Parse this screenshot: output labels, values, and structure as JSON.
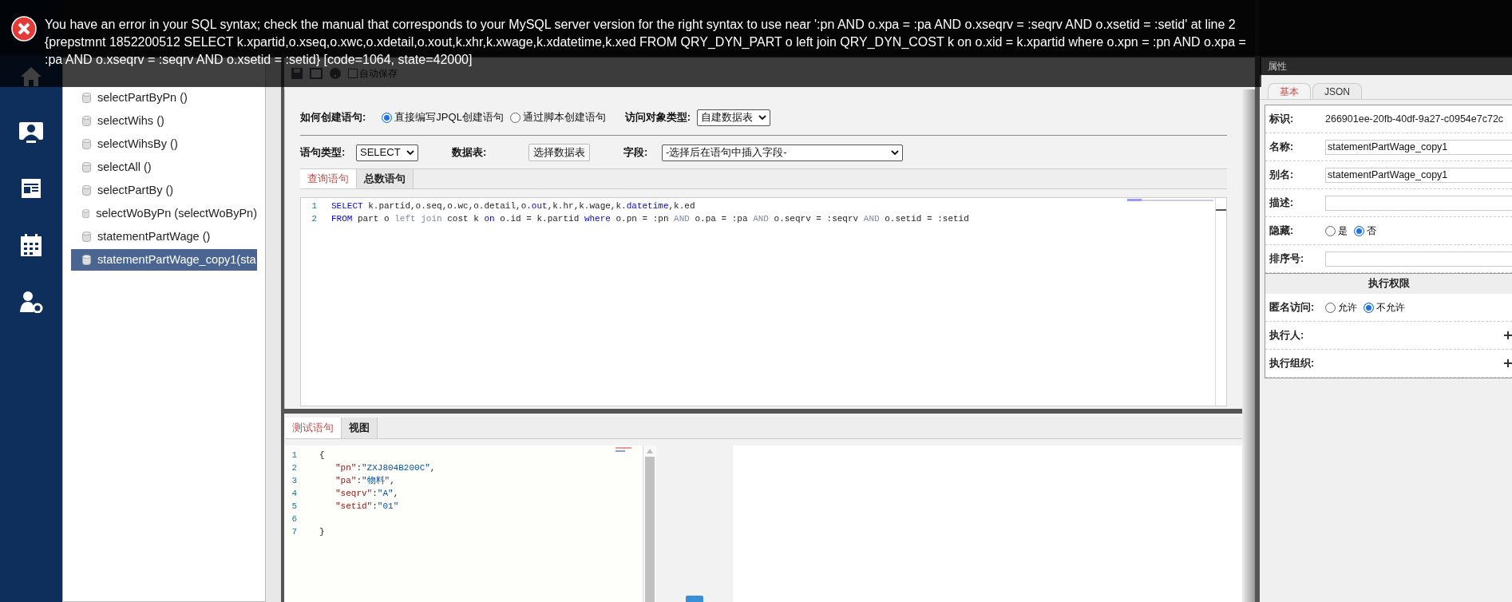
{
  "error_toast": {
    "message": "You have an error in your SQL syntax; check the manual that corresponds to your MySQL server version for the right syntax to use near ':pn AND o.xpa = :pa AND o.xseqrv = :seqrv AND o.xsetid = :setid' at line 2 {prepstmnt 1852200512 SELECT k.xpartid,o.xseq,o.xwc,o.xdetail,o.xout,k.xhr,k.xwage,k.xdatetime,k.xed FROM QRY_DYN_PART o left join QRY_DYN_COST k on o.xid = k.xpartid where o.xpn = :pn AND o.xpa = :pa AND o.xseqrv = :seqrv AND o.xsetid = :setid} [code=1064, state=42000]"
  },
  "toolbar": {
    "autosave": {
      "label": "自动保存",
      "checked": false
    }
  },
  "tree": {
    "items": [
      {
        "label": "selectPartByPn ()",
        "selected": false
      },
      {
        "label": "selectWihs ()",
        "selected": false
      },
      {
        "label": "selectWihsBy ()",
        "selected": false
      },
      {
        "label": "selectAll ()",
        "selected": false
      },
      {
        "label": "selectPartBy ()",
        "selected": false
      },
      {
        "label": "selectWoByPn (selectWoByPn)",
        "selected": false
      },
      {
        "label": "statementPartWage ()",
        "selected": false
      },
      {
        "label": "statementPartWage_copy1(sta",
        "selected": true
      }
    ]
  },
  "form": {
    "create_label": "如何创建语句:",
    "create_options": [
      {
        "label": "直接编写JPQL创建语句",
        "selected": true
      },
      {
        "label": "通过脚本创建语句",
        "selected": false
      }
    ],
    "access_label": "访问对象类型:",
    "access_value": "自建数据表",
    "type_label": "语句类型:",
    "type_value": "SELECT",
    "table_label": "数据表:",
    "table_button": "选择数据表",
    "field_label": "字段:",
    "field_value": "-选择后在语句中插入字段-"
  },
  "query_tabs": [
    {
      "label": "查询语句",
      "selected": true
    },
    {
      "label": "总数语句",
      "selected": false
    }
  ],
  "query_code": [
    {
      "number": "1",
      "tokens": [
        {
          "t": "SELECT",
          "kind": "keyword"
        },
        {
          "t": " k.partid,o.seq,o.wc,o.detail,o.",
          "kind": "plain"
        },
        {
          "t": "out",
          "kind": "keyword"
        },
        {
          "t": ",k.hr,k.wage,k.",
          "kind": "plain"
        },
        {
          "t": "datetime",
          "kind": "keyword"
        },
        {
          "t": ",k.ed",
          "kind": "plain"
        }
      ]
    },
    {
      "number": "2",
      "tokens": [
        {
          "t": "FROM",
          "kind": "keyword"
        },
        {
          "t": " part o ",
          "kind": "plain"
        },
        {
          "t": "left join",
          "kind": "operator"
        },
        {
          "t": " cost k ",
          "kind": "plain"
        },
        {
          "t": "on",
          "kind": "keyword"
        },
        {
          "t": " o.id = k.partid ",
          "kind": "plain"
        },
        {
          "t": "where",
          "kind": "keyword"
        },
        {
          "t": " o.pn = :pn ",
          "kind": "plain"
        },
        {
          "t": "AND",
          "kind": "operator"
        },
        {
          "t": " o.pa = :pa ",
          "kind": "plain"
        },
        {
          "t": "AND",
          "kind": "operator"
        },
        {
          "t": " o.seqrv = :seqrv ",
          "kind": "plain"
        },
        {
          "t": "AND",
          "kind": "operator"
        },
        {
          "t": " o.setid = :setid",
          "kind": "plain"
        }
      ]
    }
  ],
  "test_tabs": [
    {
      "label": "测试语句",
      "selected": true
    },
    {
      "label": "视图",
      "selected": false
    }
  ],
  "test_code": [
    {
      "number": "1",
      "kind": "top",
      "tokens": [
        {
          "t": "{",
          "kind": "plain"
        }
      ]
    },
    {
      "number": "2",
      "kind": "member",
      "tokens": [
        {
          "t": "\"pn\"",
          "kind": "key"
        },
        {
          "t": ":",
          "kind": "plain"
        },
        {
          "t": "\"ZXJ804B200C\"",
          "kind": "string"
        },
        {
          "t": ",",
          "kind": "plain"
        }
      ]
    },
    {
      "number": "3",
      "kind": "member",
      "tokens": [
        {
          "t": "\"pa\"",
          "kind": "key"
        },
        {
          "t": ":",
          "kind": "plain"
        },
        {
          "t": "\"物料\"",
          "kind": "string"
        },
        {
          "t": ",",
          "kind": "plain"
        }
      ]
    },
    {
      "number": "4",
      "kind": "member",
      "tokens": [
        {
          "t": "\"seqrv\"",
          "kind": "key"
        },
        {
          "t": ":",
          "kind": "plain"
        },
        {
          "t": "\"A\"",
          "kind": "string"
        },
        {
          "t": ",",
          "kind": "plain"
        }
      ]
    },
    {
      "number": "5",
      "kind": "member",
      "tokens": [
        {
          "t": "\"setid\"",
          "kind": "key"
        },
        {
          "t": ":",
          "kind": "plain"
        },
        {
          "t": "\"01\"",
          "kind": "string"
        }
      ]
    },
    {
      "number": "6",
      "kind": "top"
    },
    {
      "number": "7",
      "kind": "top",
      "tokens": [
        {
          "t": "}",
          "kind": "plain"
        }
      ]
    }
  ],
  "properties": {
    "title": "属性",
    "tabs": [
      {
        "label": "基本",
        "selected": true
      },
      {
        "label": "JSON",
        "selected": false
      }
    ],
    "rows": [
      {
        "kind": "text",
        "label": "标识:",
        "value": "266901ee-20fb-40df-9a27-c0954e7c72c"
      },
      {
        "kind": "input",
        "label": "名称:",
        "value": "statementPartWage_copy1"
      },
      {
        "kind": "input",
        "label": "别名:",
        "value": "statementPartWage_copy1"
      },
      {
        "kind": "input",
        "label": "描述:"
      },
      {
        "kind": "radio",
        "label": "隐藏:",
        "options": [
          {
            "label": "是",
            "selected": false
          },
          {
            "label": "否",
            "selected": true
          }
        ]
      },
      {
        "kind": "input",
        "label": "排序号:"
      },
      {
        "kind": "section",
        "label": "执行权限"
      },
      {
        "kind": "radio",
        "label": "匿名访问:",
        "options": [
          {
            "label": "允许",
            "selected": false
          },
          {
            "label": "不允许",
            "selected": true
          }
        ]
      },
      {
        "kind": "add",
        "label": "执行人:"
      },
      {
        "kind": "add",
        "label": "执行组织:"
      }
    ]
  }
}
